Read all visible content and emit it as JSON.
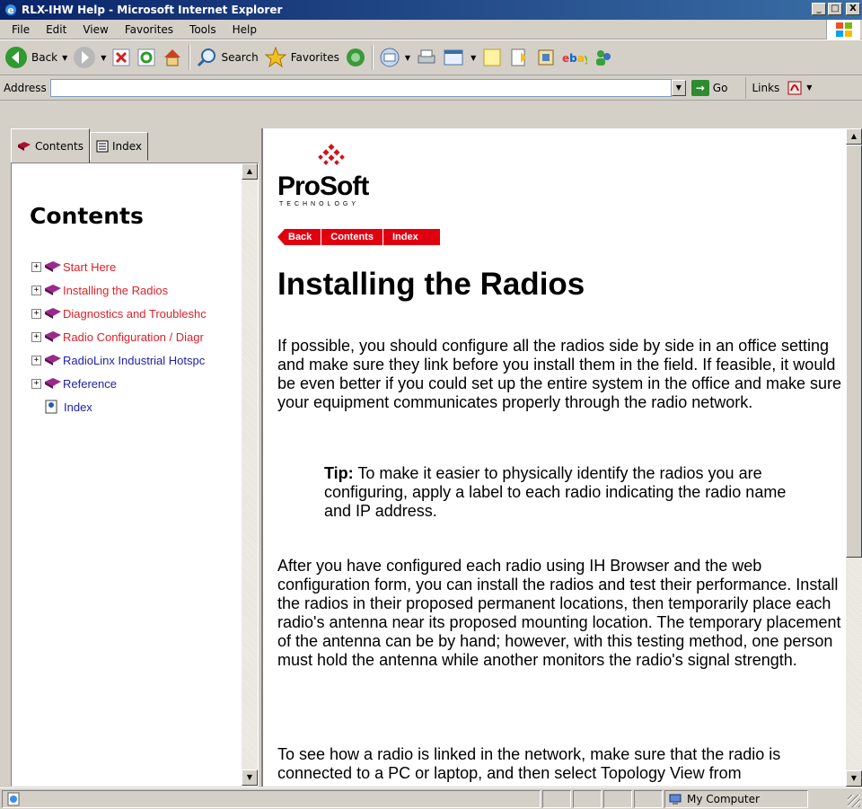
{
  "window": {
    "title": "RLX-IHW Help - Microsoft Internet Explorer",
    "minimize": "_",
    "maximize": "□",
    "close": "X"
  },
  "menu": [
    "File",
    "Edit",
    "View",
    "Favorites",
    "Tools",
    "Help"
  ],
  "toolbar": {
    "back": "Back",
    "search": "Search",
    "favorites": "Favorites"
  },
  "address": {
    "label": "Address",
    "value": "",
    "go": "Go",
    "links": "Links"
  },
  "tabs": {
    "contents": "Contents",
    "index": "Index"
  },
  "toc": {
    "heading": "Contents",
    "items": [
      {
        "label": "Start Here",
        "color": "#e0202a"
      },
      {
        "label": "Installing the Radios",
        "color": "#e0202a"
      },
      {
        "label": "Diagnostics and Troubleshc",
        "color": "#e0202a"
      },
      {
        "label": "Radio Configuration / Diagr",
        "color": "#e0202a"
      },
      {
        "label": "RadioLinx Industrial Hotspc",
        "color": "#2020b0"
      },
      {
        "label": "Reference",
        "color": "#2020b0"
      }
    ],
    "index_label": "Index"
  },
  "content": {
    "logo_text": "ProSoft",
    "logo_sub": "TECHNOLOGY",
    "nav": {
      "back": "Back",
      "contents": "Contents",
      "index": "Index"
    },
    "title": "Installing the Radios",
    "p1": "If possible, you should configure all the radios side by side in an office setting and make sure they link before you install them in the field. If feasible, it would be even better if you could set up the entire system in the office and make sure your equipment communicates properly through the radio network.",
    "tip_label": "Tip:",
    "tip_text": "To make it easier to physically identify the radios you are configuring, apply a label to each radio indicating the radio name and IP address.",
    "p2": "After you have configured each radio using IH Browser and the web configuration form, you can install the radios and test their performance. Install the radios in their proposed permanent locations, then temporarily place each radio's antenna near its proposed mounting location. The temporary placement of the antenna can be by hand; however, with this testing method, one person must hold the antenna while another monitors the radio's signal strength.",
    "p3": "To see how a radio is linked in the network, make sure that the radio is connected to a PC or laptop, and then select Topology View from"
  },
  "status": {
    "zone": "My Computer"
  }
}
